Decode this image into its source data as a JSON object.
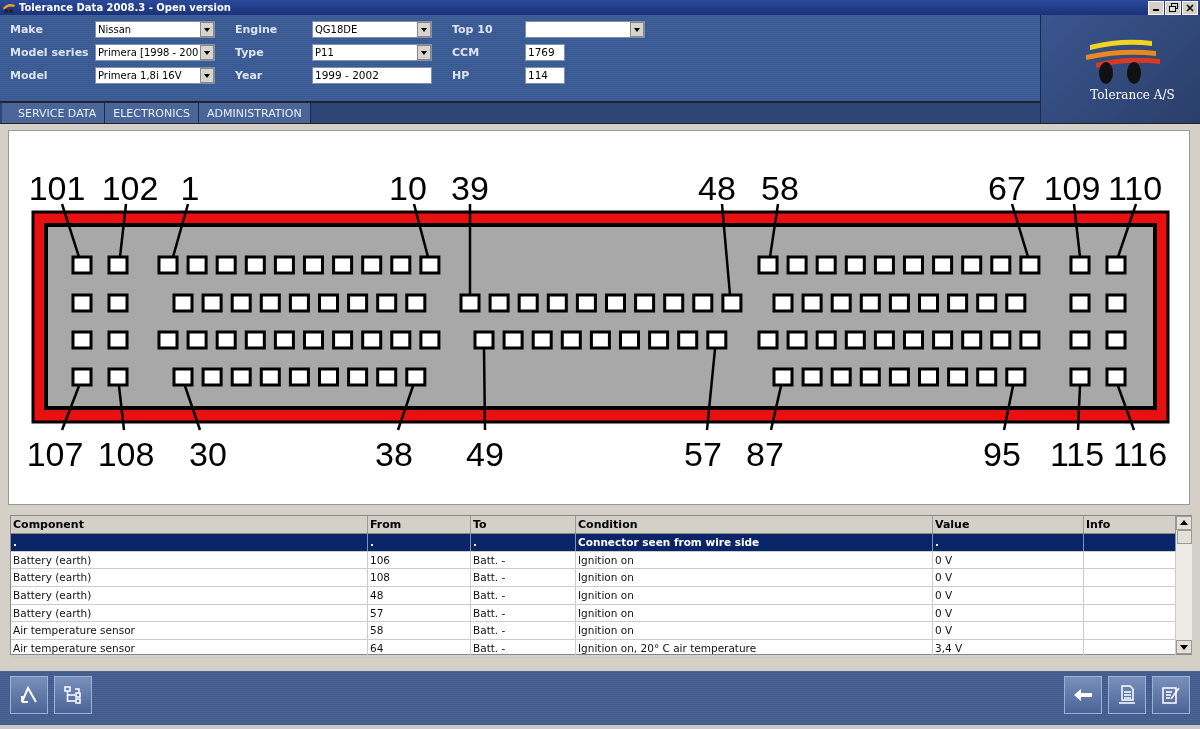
{
  "window": {
    "title": "Tolerance Data 2008.3 - Open version"
  },
  "vehicle_form": {
    "columns": [
      [
        {
          "label": "Make",
          "kind": "select",
          "value": "Nissan"
        },
        {
          "label": "Model series",
          "kind": "select",
          "value": "Primera [1998 - 200"
        },
        {
          "label": "Model",
          "kind": "select",
          "value": "Primera 1,8i 16V"
        }
      ],
      [
        {
          "label": "Engine",
          "kind": "select",
          "value": "QG18DE"
        },
        {
          "label": "Type",
          "kind": "select",
          "value": "P11"
        },
        {
          "label": "Year",
          "kind": "input",
          "value": "1999 - 2002"
        }
      ],
      [
        {
          "label": "Top 10",
          "kind": "select"
        },
        {
          "label": "CCM",
          "kind": "input",
          "value": "1769"
        },
        {
          "label": "HP",
          "kind": "input",
          "value": "114"
        }
      ]
    ]
  },
  "logo": {
    "text": "Tolerance A/S"
  },
  "tabs": [
    {
      "label": "SERVICE DATA",
      "selected": false
    },
    {
      "label": "ELECTRONICS",
      "selected": false
    },
    {
      "label": "ADMINISTRATION",
      "selected": false
    }
  ],
  "connector": {
    "top_labels": [
      "101",
      "102",
      "1",
      "10",
      "39",
      "48",
      "58",
      "67",
      "109",
      "110"
    ],
    "bottom_labels": [
      "107",
      "108",
      "30",
      "38",
      "49",
      "57",
      "87",
      "95",
      "115",
      "116"
    ]
  },
  "table": {
    "columns": [
      "Component",
      "From",
      "To",
      "Condition",
      "Value",
      "Info"
    ],
    "rows": [
      {
        "cells": [
          ".",
          ".",
          ".",
          "Connector seen from wire side",
          ".",
          ""
        ],
        "selected": true
      },
      {
        "cells": [
          "Battery (earth)",
          "106",
          "Batt. -",
          "Ignition on",
          "0 V",
          ""
        ],
        "selected": false
      },
      {
        "cells": [
          "Battery (earth)",
          "108",
          "Batt. -",
          "Ignition on",
          "0 V",
          ""
        ],
        "selected": false
      },
      {
        "cells": [
          "Battery (earth)",
          "48",
          "Batt. -",
          "Ignition on",
          "0 V",
          ""
        ],
        "selected": false
      },
      {
        "cells": [
          "Battery (earth)",
          "57",
          "Batt. -",
          "Ignition on",
          "0  V",
          ""
        ],
        "selected": false
      },
      {
        "cells": [
          "Air temperature sensor",
          "58",
          "Batt. -",
          "Ignition on",
          "0 V",
          ""
        ],
        "selected": false
      },
      {
        "cells": [
          "Air temperature sensor",
          "64",
          "Batt. -",
          "Ignition on, 20° C air temperature",
          "3,4 V",
          ""
        ],
        "selected": false
      }
    ]
  }
}
